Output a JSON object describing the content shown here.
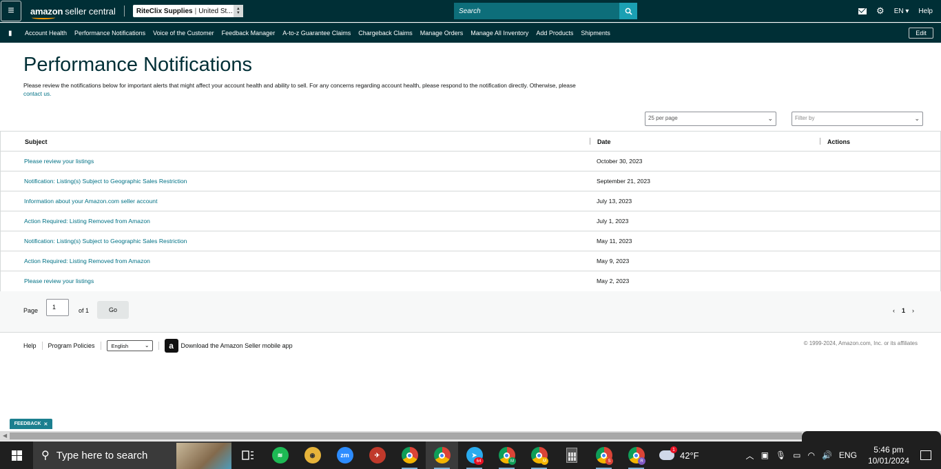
{
  "header": {
    "logo_brand": "amazon",
    "logo_product": "seller central",
    "store_name": "RiteClix Supplies",
    "store_marketplace": "United St...",
    "search_placeholder": "Search",
    "language": "EN",
    "help": "Help"
  },
  "nav": {
    "items": [
      "Account Health",
      "Performance Notifications",
      "Voice of the Customer",
      "Feedback Manager",
      "A-to-z Guarantee Claims",
      "Chargeback Claims",
      "Manage Orders",
      "Manage All Inventory",
      "Add Products",
      "Shipments"
    ],
    "edit_label": "Edit"
  },
  "page": {
    "title": "Performance Notifications",
    "description": "Please review the notifications below for important alerts that might affect your account health and ability to sell. For any concerns regarding account health, please respond to the notification directly. Otherwise, please",
    "contact_link": "contact us."
  },
  "controls": {
    "per_page": "25 per page",
    "filter_placeholder": "Filter by"
  },
  "table": {
    "headers": {
      "subject": "Subject",
      "date": "Date",
      "actions": "Actions"
    },
    "rows": [
      {
        "subject": "Please review your listings",
        "date": "October 30, 2023"
      },
      {
        "subject": "Notification: Listing(s) Subject to Geographic Sales Restriction",
        "date": "September 21, 2023"
      },
      {
        "subject": "Information about your Amazon.com seller account",
        "date": "July 13, 2023"
      },
      {
        "subject": "Action Required: Listing Removed from Amazon",
        "date": "July 1, 2023"
      },
      {
        "subject": "Notification: Listing(s) Subject to Geographic Sales Restriction",
        "date": "May 11, 2023"
      },
      {
        "subject": "Action Required: Listing Removed from Amazon",
        "date": "May 9, 2023"
      },
      {
        "subject": "Please review your listings",
        "date": "May 2, 2023"
      }
    ]
  },
  "pagination": {
    "page_label": "Page",
    "page_value": "1",
    "of_label": "of 1",
    "go_label": "Go",
    "current_page": "1"
  },
  "footer": {
    "help": "Help",
    "program_policies": "Program Policies",
    "language_selected": "English",
    "app_download": "Download the Amazon Seller mobile app",
    "copyright": "© 1999-2024, Amazon.com, Inc. or its affiliates"
  },
  "feedback": {
    "label": "FEEDBACK"
  },
  "taskbar": {
    "search_placeholder": "Type here to search",
    "weather_temp": "42°F",
    "weather_badge": "1",
    "language": "ENG",
    "time": "5:46 pm",
    "date": "10/01/2024",
    "apps": [
      {
        "name": "task-view-icon"
      },
      {
        "name": "spotify-icon",
        "color": "#1db954"
      },
      {
        "name": "cyberduck-icon",
        "color": "#e6b33a"
      },
      {
        "name": "zoom-icon",
        "color": "#2d8cff",
        "text": "zm"
      },
      {
        "name": "network-app-icon",
        "color": "#c0392b"
      },
      {
        "name": "chrome-icon",
        "color": "#db4437"
      },
      {
        "name": "chrome-icon",
        "color": "#4285f4",
        "active": true
      },
      {
        "name": "telegram-icon",
        "color": "#2aabee",
        "badge": "64"
      },
      {
        "name": "chrome-icon",
        "color": "#0f9d58",
        "badge": "M"
      },
      {
        "name": "chrome-icon",
        "color": "#f4b400",
        "badge": "M"
      },
      {
        "name": "calculator-icon",
        "color": "#555555"
      },
      {
        "name": "chrome-icon",
        "color": "#db4437",
        "badge": "S"
      },
      {
        "name": "chrome-icon",
        "color": "#7e57c2",
        "badge": "R"
      }
    ]
  },
  "colors": {
    "header_bg": "#002f36",
    "link": "#007185",
    "search_bg": "#0d6e7a",
    "search_button": "#1ba0b3",
    "feedback_bg": "#1c7f8f"
  }
}
